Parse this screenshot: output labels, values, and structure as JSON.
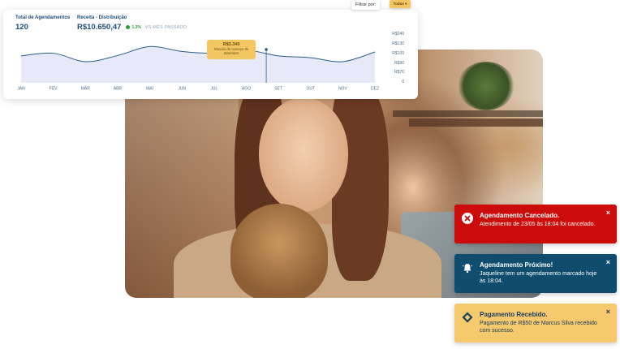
{
  "stats": {
    "total_label": "Total de Agendamentos",
    "total_value": "120",
    "revenue_label": "Receita - Distribuição",
    "revenue_value": "R$10.650,47",
    "change": "1,3%",
    "compare": "VS MÊS PASSADO"
  },
  "filter": {
    "label": "Filtrar por:",
    "value": "Todos"
  },
  "chart_data": {
    "type": "area",
    "categories": [
      "JAN",
      "FEV",
      "MAR",
      "ABR",
      "MAI",
      "JUN",
      "JUL",
      "AGO",
      "SET",
      "OUT",
      "NOV",
      "DEZ"
    ],
    "values": [
      150,
      165,
      118,
      152,
      202,
      175,
      165,
      182,
      150,
      140,
      118,
      172
    ],
    "y_ticks": [
      "R$240",
      "R$130",
      "R$100",
      "R$90",
      "R$70",
      "0"
    ],
    "highlight": {
      "value_label": "R$3.340",
      "note": "Receita do começo de Setembro"
    },
    "fill_color": "#e8e9f8",
    "line_color": "#2a5f86"
  },
  "notifications": [
    {
      "type": "error",
      "title": "Agendamento Cancelado.",
      "message": "Atendimento de 23/05 às 18:04 foi cancelado.",
      "close": "×"
    },
    {
      "type": "reminder",
      "title": "Agendamento Próximo!",
      "message": "Jaqueline tem um agendamento marcado hoje às 18:04.",
      "close": "×"
    },
    {
      "type": "payment",
      "title": "Pagamento Recebido.",
      "message": "Pagamento de R$50 de Marcus Silva recebido com sucesso.",
      "close": "×"
    }
  ]
}
